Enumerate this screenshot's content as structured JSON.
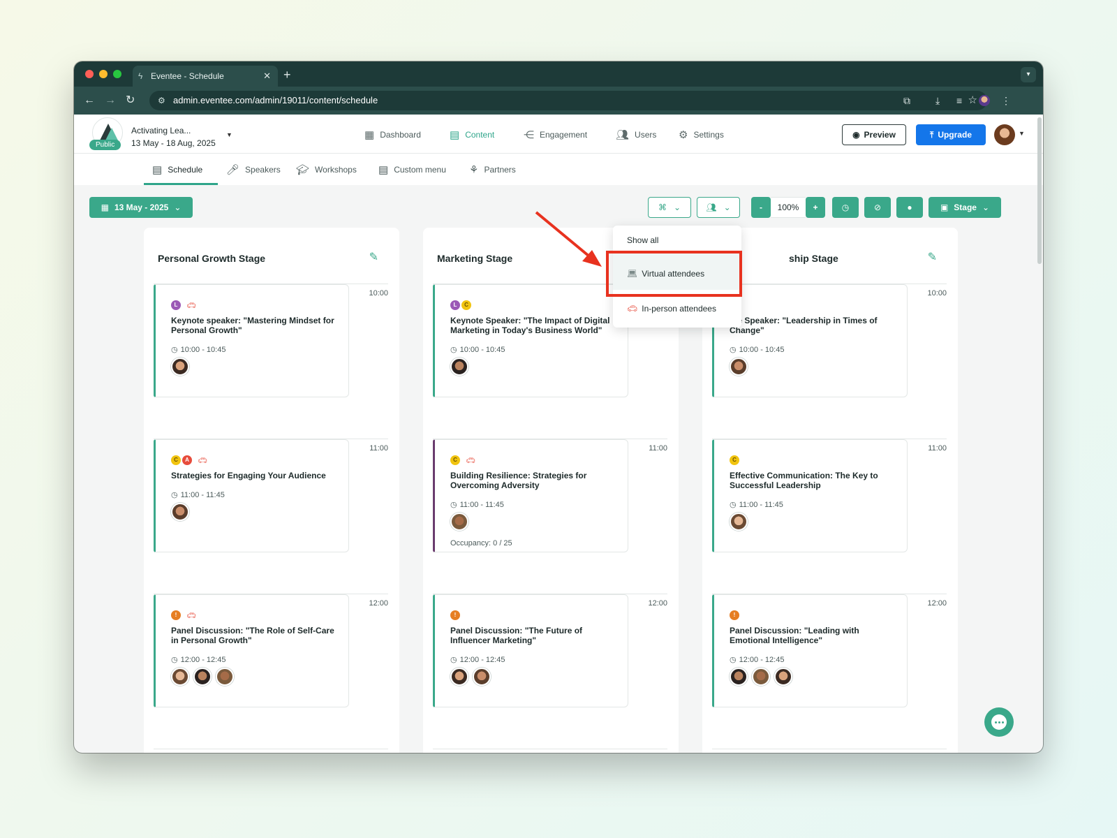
{
  "browser": {
    "tab_title": "Eventee - Schedule",
    "url": "admin.eventee.com/admin/19011/content/schedule"
  },
  "event": {
    "name": "Activating Lea...",
    "dates": "13 May - 18 Aug, 2025",
    "visibility": "Public"
  },
  "main_nav": {
    "dashboard": "Dashboard",
    "content": "Content",
    "engagement": "Engagement",
    "users": "Users",
    "settings": "Settings"
  },
  "actions": {
    "preview": "Preview",
    "upgrade": "Upgrade"
  },
  "sub_nav": {
    "schedule": "Schedule",
    "speakers": "Speakers",
    "workshops": "Workshops",
    "custom_menu": "Custom menu",
    "partners": "Partners"
  },
  "toolbar": {
    "date": "13 May - 2025",
    "zoom_out": "-",
    "zoom": "100%",
    "zoom_in": "+",
    "view": "Stage"
  },
  "dropdown": {
    "show_all": "Show all",
    "virtual": "Virtual attendees",
    "in_person": "In-person attendees"
  },
  "columns": [
    {
      "title": "Personal Growth Stage",
      "sessions": [
        {
          "time_slot": "10:00",
          "title": "Keynote speaker: \"Mastering Mindset for Personal Growth\"",
          "time": "10:00 - 10:45"
        },
        {
          "time_slot": "11:00",
          "title": "Strategies for Engaging Your Audience",
          "time": "11:00 - 11:45"
        },
        {
          "time_slot": "12:00",
          "title": "Panel Discussion: \"The Role of Self-Care in Personal Growth\"",
          "time": "12:00 - 12:45"
        }
      ]
    },
    {
      "title": "Marketing Stage",
      "sessions": [
        {
          "time_slot": "10:00",
          "title": "Keynote Speaker: \"The Impact of Digital Marketing in Today's Business World\"",
          "time": "10:00 - 10:45"
        },
        {
          "time_slot": "11:00",
          "title": "Building Resilience: Strategies for Overcoming Adversity",
          "time": "11:00 - 11:45",
          "occupancy": "Occupancy: 0 / 25"
        },
        {
          "time_slot": "12:00",
          "title": "Panel Discussion: \"The Future of Influencer Marketing\"",
          "time": "12:00 - 12:45"
        }
      ]
    },
    {
      "title": "ship Stage",
      "sessions": [
        {
          "time_slot": "10:00",
          "title": "ote Speaker: \"Leadership in Times of Change\"",
          "title_line2": "Change\"",
          "time": "10:00 - 10:45"
        },
        {
          "time_slot": "11:00",
          "title": "Effective Communication: The Key to Successful Leadership",
          "time": "11:00 - 11:45"
        },
        {
          "time_slot": "12:00",
          "title": "Panel Discussion: \"Leading with Emotional Intelligence\"",
          "time": "12:00 - 12:45"
        }
      ]
    }
  ],
  "tag_letters": {
    "L": "L",
    "C": "C",
    "A": "A",
    "I": "!"
  },
  "colors": {
    "accent": "#3aa88a",
    "upgrade": "#1476ea",
    "annotation": "#e8321f"
  }
}
